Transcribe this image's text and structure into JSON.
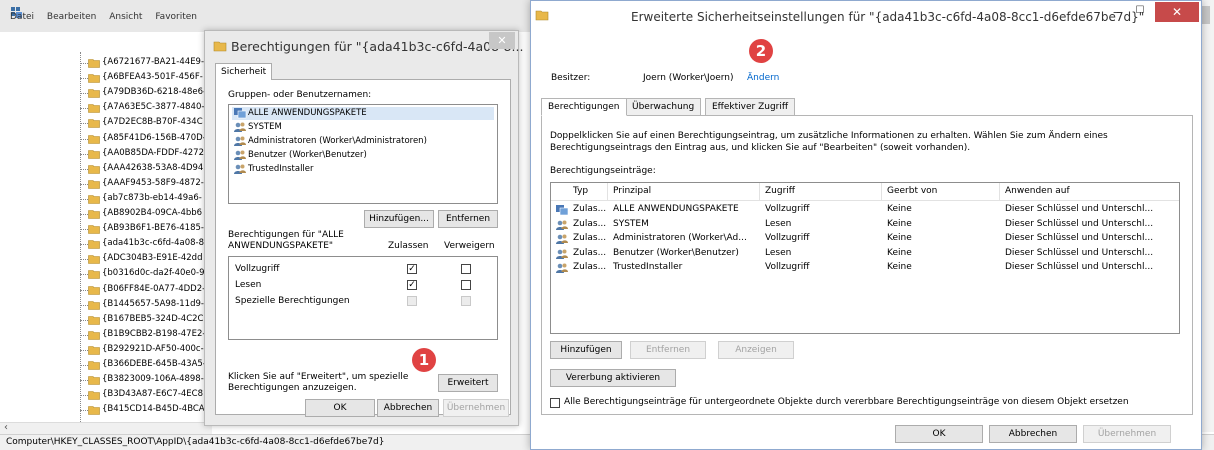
{
  "regedit": {
    "menu": [
      "Datei",
      "Bearbeiten",
      "Ansicht",
      "Favoriten"
    ],
    "tree_items": [
      "{A6721677-BA21-44E9-",
      "{A6BFEA43-501F-456F-",
      "{A79DB36D-6218-48e6-",
      "{A7A63E5C-3877-4840-",
      "{A7D2EC8B-B70F-434C",
      "{A85F41D6-156B-470D-",
      "{AA0B85DA-FDDF-4272",
      "{AAA42638-53A8-4D94",
      "{AAAF9453-58F9-4872-",
      "{ab7c873b-eb14-49a6-",
      "{AB8902B4-09CA-4bb6",
      "{AB93B6F1-BE76-4185-",
      "{ada41b3c-c6fd-4a08-8",
      "{ADC304B3-E91E-42dd",
      "{b0316d0c-da2f-40e0-9",
      "{B06FF84E-0A77-4DD2-",
      "{B1445657-5A98-11d9-",
      "{B167BEB5-324D-4C2C",
      "{B1B9CBB2-B198-47E2-",
      "{B292921D-AF50-400c-",
      "{B366DEBE-645B-43A5-",
      "{B3823009-106A-4898-",
      "{B3D43A87-E6C7-4EC8",
      "{B415CD14-B45D-4BCA"
    ],
    "status_path": "Computer\\HKEY_CLASSES_ROOT\\AppID\\{ada41b3c-c6fd-4a08-8cc1-d6efde67be7d}"
  },
  "perm_dialog": {
    "title": "Berechtigungen für \"{ada41b3c-c6fd-4a08-8...",
    "tab": "Sicherheit",
    "groups_label": "Gruppen- oder Benutzernamen:",
    "groups": [
      {
        "name": "ALLE ANWENDUNGSPAKETE",
        "icon": "app-packages-icon",
        "selected": true
      },
      {
        "name": "SYSTEM",
        "icon": "users-icon",
        "selected": false
      },
      {
        "name": "Administratoren (Worker\\Administratoren)",
        "icon": "users-icon",
        "selected": false
      },
      {
        "name": "Benutzer (Worker\\Benutzer)",
        "icon": "users-icon",
        "selected": false
      },
      {
        "name": "TrustedInstaller",
        "icon": "users-icon",
        "selected": false
      }
    ],
    "add_button": "Hinzufügen...",
    "remove_button": "Entfernen",
    "perms_for_label_line1": "Berechtigungen für \"ALLE",
    "perms_for_label_line2": "ANWENDUNGSPAKETE\"",
    "allow_header": "Zulassen",
    "deny_header": "Verweigern",
    "permissions": [
      {
        "name": "Vollzugriff",
        "allow": "checked",
        "deny": "unchecked"
      },
      {
        "name": "Lesen",
        "allow": "checked",
        "deny": "unchecked"
      },
      {
        "name": "Spezielle Berechtigungen",
        "allow": "disabled",
        "deny": "disabled"
      }
    ],
    "advanced_hint_line1": "Klicken Sie auf \"Erweitert\", um spezielle",
    "advanced_hint_line2": "Berechtigungen anzuzeigen.",
    "advanced_button": "Erweitert",
    "ok_button": "OK",
    "cancel_button": "Abbrechen",
    "apply_button": "Übernehmen",
    "badge": "1"
  },
  "advanced": {
    "title": "Erweiterte Sicherheitseinstellungen für \"{ada41b3c-c6fd-4a08-8cc1-d6efde67be7d}\"",
    "owner_label": "Besitzer:",
    "owner_value": "Joern (Worker\\Joern)",
    "owner_change": "Ändern",
    "badge": "2",
    "tabs": [
      "Berechtigungen",
      "Überwachung",
      "Effektiver Zugriff"
    ],
    "description_line1": "Doppelklicken Sie auf einen Berechtigungseintrag, um zusätzliche Informationen zu erhalten. Wählen Sie zum Ändern eines",
    "description_line2": "Berechtigungseintrags den Eintrag aus, und klicken Sie auf \"Bearbeiten\" (soweit vorhanden).",
    "entries_label": "Berechtigungseinträge:",
    "columns": [
      "Typ",
      "Prinzipal",
      "Zugriff",
      "Geerbt von",
      "Anwenden auf"
    ],
    "entries": [
      {
        "type": "Zulas...",
        "principal": "ALLE ANWENDUNGSPAKETE",
        "access": "Vollzugriff",
        "inherited": "Keine",
        "applies": "Dieser Schlüssel und Unterschl...",
        "icon": "app-packages-icon"
      },
      {
        "type": "Zulas...",
        "principal": "SYSTEM",
        "access": "Lesen",
        "inherited": "Keine",
        "applies": "Dieser Schlüssel und Unterschl...",
        "icon": "users-icon"
      },
      {
        "type": "Zulas...",
        "principal": "Administratoren (Worker\\Ad...",
        "access": "Vollzugriff",
        "inherited": "Keine",
        "applies": "Dieser Schlüssel und Unterschl...",
        "icon": "users-icon"
      },
      {
        "type": "Zulas...",
        "principal": "Benutzer (Worker\\Benutzer)",
        "access": "Lesen",
        "inherited": "Keine",
        "applies": "Dieser Schlüssel und Unterschl...",
        "icon": "users-icon"
      },
      {
        "type": "Zulas...",
        "principal": "TrustedInstaller",
        "access": "Vollzugriff",
        "inherited": "Keine",
        "applies": "Dieser Schlüssel und Unterschl...",
        "icon": "users-icon"
      }
    ],
    "add_button": "Hinzufügen",
    "remove_button": "Entfernen",
    "view_button": "Anzeigen",
    "enable_inheritance_button": "Vererbung aktivieren",
    "replace_checkbox_label": "Alle Berechtigungseinträge für untergeordnete Objekte durch vererbbare Berechtigungseinträge von diesem Objekt ersetzen",
    "ok_button": "OK",
    "cancel_button": "Abbrechen",
    "apply_button": "Übernehmen"
  },
  "colors": {
    "accent": "#0066cc",
    "badge": "#e04343",
    "close": "#c74a4a",
    "folder": "#e8b84a"
  }
}
